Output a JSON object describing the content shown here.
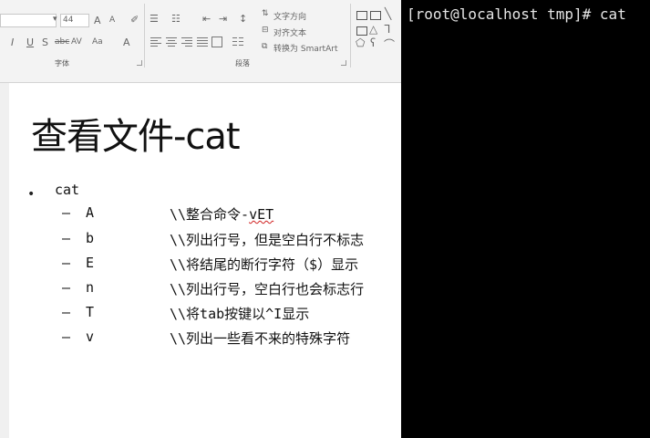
{
  "ribbon": {
    "font_group": {
      "font_size": "44",
      "label": "字体",
      "bold": "I",
      "underline": "U",
      "shadow": "S",
      "strike": "abc",
      "spacing": "AV",
      "case": "Aa",
      "color": "A",
      "grow": "A",
      "shrink": "A"
    },
    "paragraph_group": {
      "label": "段落",
      "text_direction": "文字方向",
      "align_text": "对齐文本",
      "convert_smartart": "转换为 SmartArt"
    }
  },
  "slide": {
    "title": "查看文件-cat",
    "bullet": "•",
    "item": "cat",
    "options": [
      {
        "dash": "–",
        "flag": "A",
        "desc_pre": "\\\\整合命令-",
        "desc_mark": "vET",
        "desc": ""
      },
      {
        "dash": "–",
        "flag": "b",
        "desc_pre": "",
        "desc_mark": "",
        "desc": "\\\\列出行号，但是空白行不标志"
      },
      {
        "dash": "–",
        "flag": "E",
        "desc_pre": "",
        "desc_mark": "",
        "desc": "\\\\将结尾的断行字符（$）显示"
      },
      {
        "dash": "–",
        "flag": "n",
        "desc_pre": "",
        "desc_mark": "",
        "desc": "\\\\列出行号，空白行也会标志行"
      },
      {
        "dash": "–",
        "flag": "T",
        "desc_pre": "",
        "desc_mark": "",
        "desc": "\\\\将tab按键以^I显示"
      },
      {
        "dash": "–",
        "flag": "v",
        "desc_pre": "",
        "desc_mark": "",
        "desc": "\\\\列出一些看不来的特殊字符"
      }
    ]
  },
  "terminal": {
    "prompt": "[root@localhost tmp]# cat"
  }
}
